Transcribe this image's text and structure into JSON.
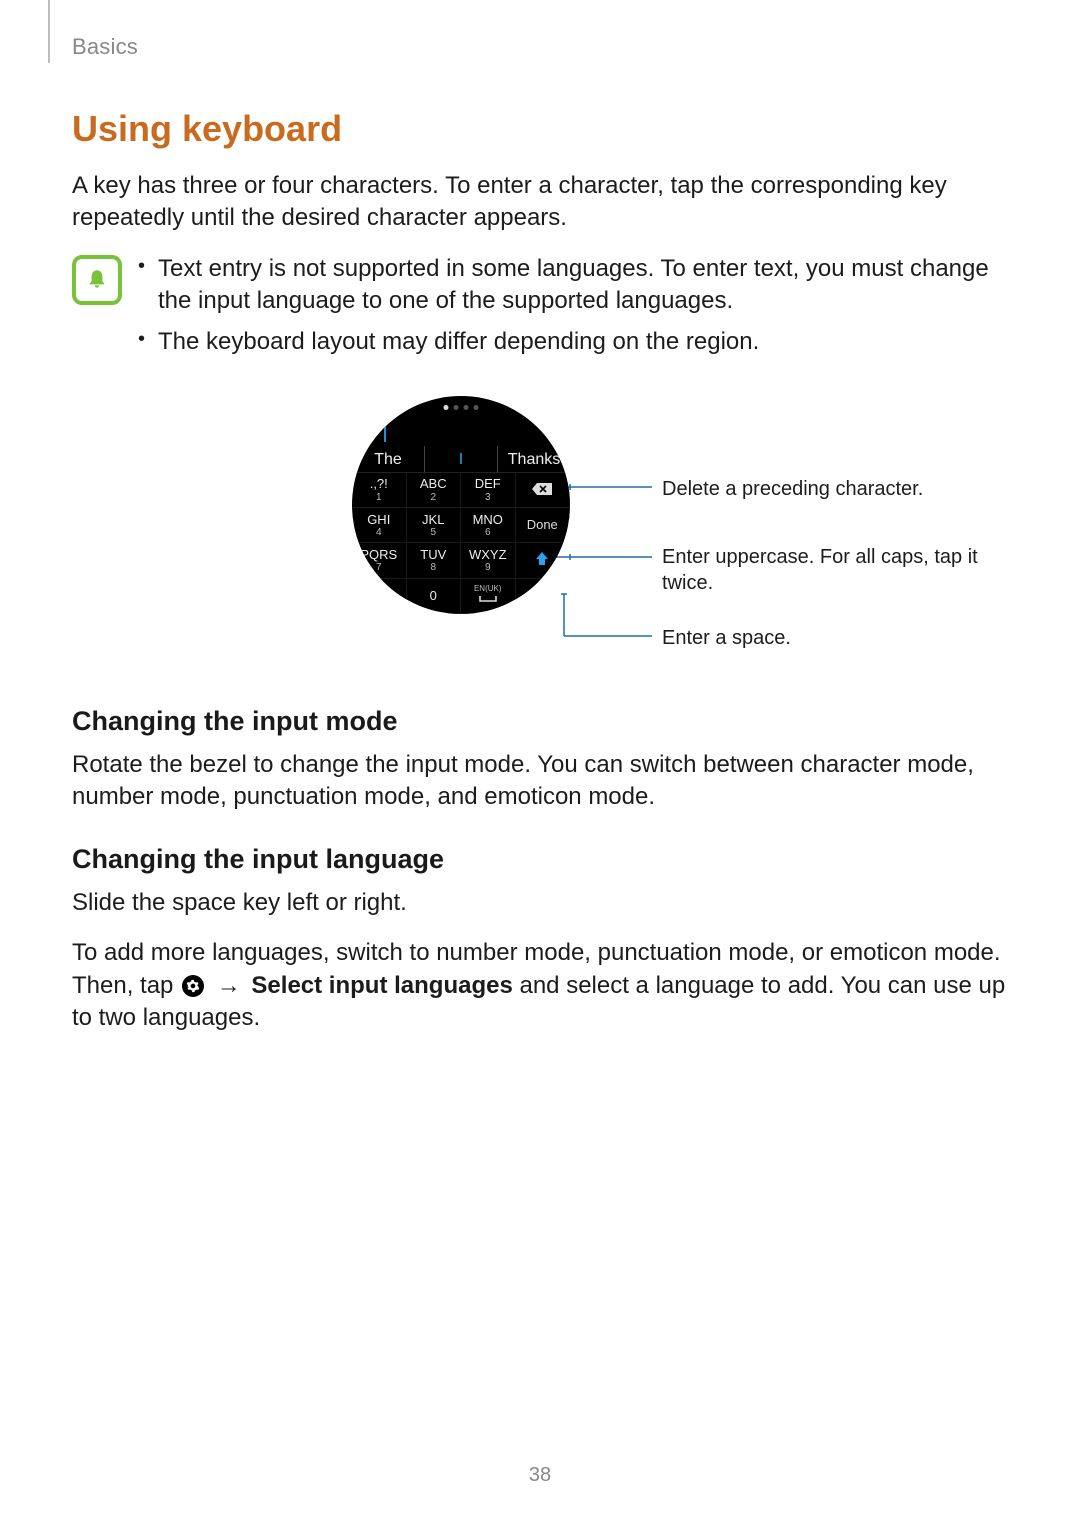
{
  "header": {
    "section_label": "Basics"
  },
  "title": "Using keyboard",
  "intro": "A key has three or four characters. To enter a character, tap the corresponding key repeatedly until the desired character appears.",
  "notes": [
    "Text entry is not supported in some languages. To enter text, you must change the input language to one of the supported languages.",
    "The keyboard layout may differ depending on the region."
  ],
  "watch": {
    "suggestions": {
      "left": "The",
      "center": "I",
      "right": "Thanks"
    },
    "keys": {
      "r1": [
        {
          "top": ".,?!",
          "bottom": "1"
        },
        {
          "top": "ABC",
          "bottom": "2"
        },
        {
          "top": "DEF",
          "bottom": "3"
        },
        {
          "icon": "backspace"
        }
      ],
      "r2": [
        {
          "top": "GHI",
          "bottom": "4"
        },
        {
          "top": "JKL",
          "bottom": "5"
        },
        {
          "top": "MNO",
          "bottom": "6"
        },
        {
          "label": "Done"
        }
      ],
      "r3": [
        {
          "top": "PQRS",
          "bottom": "7"
        },
        {
          "top": "TUV",
          "bottom": "8"
        },
        {
          "top": "WXYZ",
          "bottom": "9"
        },
        {
          "icon": "shift"
        }
      ],
      "r4": [
        {
          "blank": true
        },
        {
          "top": "0",
          "bottom": ""
        },
        {
          "top": "EN(UK)",
          "icon": "space"
        },
        {
          "blank": true
        }
      ]
    }
  },
  "callouts": {
    "delete": "Delete a preceding character.",
    "uppercase": "Enter uppercase. For all caps, tap it twice.",
    "space": "Enter a space."
  },
  "sub1": {
    "heading": "Changing the input mode",
    "body": "Rotate the bezel to change the input mode. You can switch between character mode, number mode, punctuation mode, and emoticon mode."
  },
  "sub2": {
    "heading": "Changing the input language",
    "line1": "Slide the space key left or right.",
    "line2a": "To add more languages, switch to number mode, punctuation mode, or emoticon mode. Then, tap ",
    "arrow": "→",
    "bold": " Select input languages",
    "line2b": " and select a language to add. You can use up to two languages."
  },
  "page_number": "38"
}
